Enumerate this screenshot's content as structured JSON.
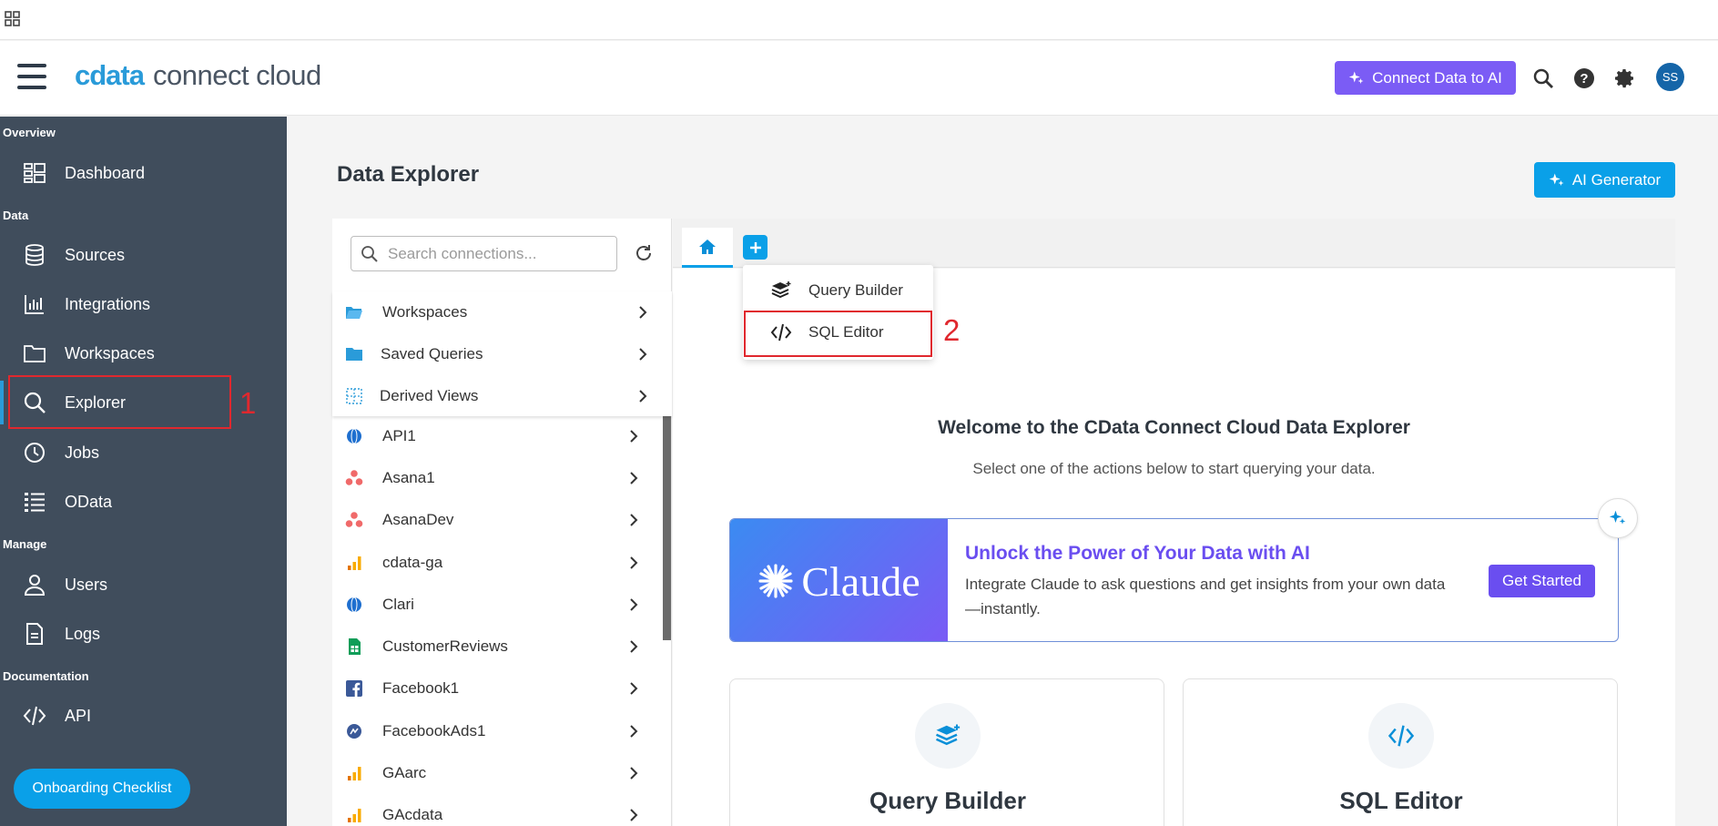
{
  "header": {
    "brand": "cdata",
    "product": "connect cloud",
    "connect_ai_label": "Connect Data to AI",
    "avatar_initials": "SS"
  },
  "sidebar": {
    "sections": {
      "overview": "Overview",
      "data": "Data",
      "manage": "Manage",
      "documentation": "Documentation"
    },
    "items": [
      {
        "label": "Dashboard",
        "icon": "dashboard-icon"
      },
      {
        "label": "Sources",
        "icon": "database-icon"
      },
      {
        "label": "Integrations",
        "icon": "bar-chart-icon"
      },
      {
        "label": "Workspaces",
        "icon": "folder-icon"
      },
      {
        "label": "Explorer",
        "icon": "search-icon",
        "active": true
      },
      {
        "label": "Jobs",
        "icon": "clock-icon"
      },
      {
        "label": "OData",
        "icon": "odata-icon"
      },
      {
        "label": "Users",
        "icon": "user-icon"
      },
      {
        "label": "Logs",
        "icon": "document-icon"
      },
      {
        "label": "API",
        "icon": "code-icon"
      }
    ],
    "onboarding_label": "Onboarding Checklist"
  },
  "annotations": {
    "one": "1",
    "two": "2"
  },
  "main": {
    "title": "Data Explorer",
    "ai_generator_label": "AI Generator"
  },
  "connections": {
    "search_placeholder": "Search connections...",
    "groups": [
      {
        "label": "Workspaces",
        "icon": "folder-open-icon"
      },
      {
        "label": "Saved Queries",
        "icon": "folder-icon"
      },
      {
        "label": "Derived Views",
        "icon": "grid-icon"
      }
    ],
    "items": [
      {
        "label": "API1",
        "icon": "api-icon"
      },
      {
        "label": "Asana1",
        "icon": "asana-icon"
      },
      {
        "label": "AsanaDev",
        "icon": "asana-icon"
      },
      {
        "label": "cdata-ga",
        "icon": "google-analytics-icon"
      },
      {
        "label": "Clari",
        "icon": "clari-icon"
      },
      {
        "label": "CustomerReviews",
        "icon": "google-sheets-icon"
      },
      {
        "label": "Facebook1",
        "icon": "facebook-icon"
      },
      {
        "label": "FacebookAds1",
        "icon": "facebook-ads-icon"
      },
      {
        "label": "GAarc",
        "icon": "google-analytics-icon"
      },
      {
        "label": "GAcdata",
        "icon": "google-analytics-icon"
      }
    ]
  },
  "dropdown": {
    "items": [
      {
        "label": "Query Builder",
        "icon": "layers-icon"
      },
      {
        "label": "SQL Editor",
        "icon": "code-icon"
      }
    ]
  },
  "welcome": {
    "title": "Welcome to the CData Connect Cloud Data Explorer",
    "subtitle": "Select one of the actions below to start querying your data."
  },
  "promo": {
    "logo_word": "Claude",
    "title": "Unlock the Power of Your Data with AI",
    "text": "Integrate Claude to ask questions and get insights from your own data\n—instantly.",
    "button": "Get Started"
  },
  "cards": [
    {
      "title": "Query Builder",
      "icon": "layers-icon"
    },
    {
      "title": "SQL Editor",
      "icon": "code-icon"
    }
  ],
  "colors": {
    "sidebar_bg": "#404d5c",
    "accent_blue": "#0aa0e8",
    "ai_purple": "#7b5cf5",
    "annotation_red": "#e0282e"
  }
}
